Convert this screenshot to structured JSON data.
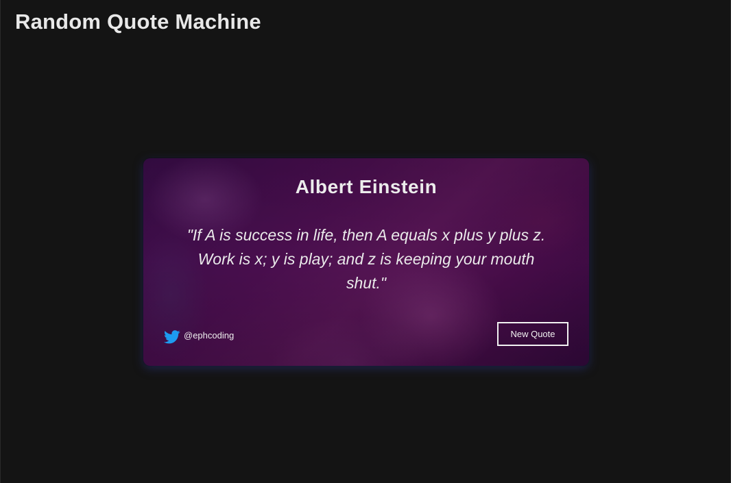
{
  "page": {
    "title": "Random Quote Machine"
  },
  "quote_card": {
    "author": "Albert Einstein",
    "quote": "\"If A is success in life, then A equals x plus y plus z. Work is x; y is play; and z is keeping your mouth shut.\"",
    "twitter": {
      "icon": "twitter-bird-icon",
      "handle": "@ephcoding"
    },
    "new_quote_label": "New Quote"
  },
  "colors": {
    "background": "#141414",
    "card_tint": "#4d0f52",
    "twitter_blue": "#1d9bf0",
    "text": "#e6e6e6"
  }
}
